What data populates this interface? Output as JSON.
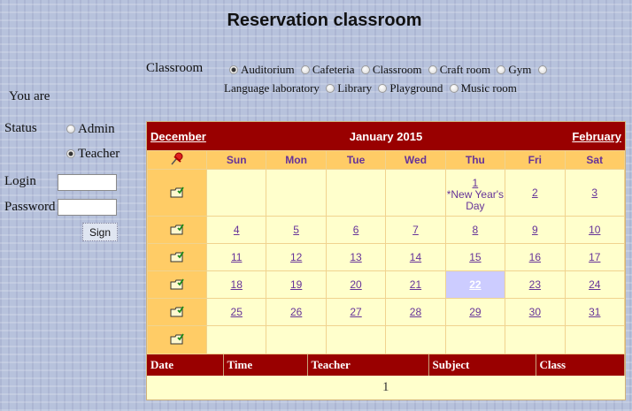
{
  "page": {
    "title": "Reservation classroom"
  },
  "classroom": {
    "label": "Classroom",
    "options": [
      {
        "label": "Auditorium",
        "checked": true
      },
      {
        "label": "Cafeteria",
        "checked": false
      },
      {
        "label": "Classroom",
        "checked": false
      },
      {
        "label": "Craft room",
        "checked": false
      },
      {
        "label": "Gym",
        "checked": false
      },
      {
        "label": "Language laboratory",
        "checked": false
      },
      {
        "label": "Library",
        "checked": false
      },
      {
        "label": "Playground",
        "checked": false
      },
      {
        "label": "Music room",
        "checked": false
      }
    ]
  },
  "login": {
    "you_are": "You are",
    "status_label": "Status",
    "status_options": [
      {
        "label": "Admin",
        "checked": false
      },
      {
        "label": "Teacher",
        "checked": true
      }
    ],
    "login_label": "Login",
    "password_label": "Password",
    "login_value": "",
    "password_value": "",
    "sign_label": "Sign"
  },
  "calendar": {
    "prev": "December",
    "month": "January 2015",
    "next": "February",
    "weekdays": [
      "Sun",
      "Mon",
      "Tue",
      "Wed",
      "Thu",
      "Fri",
      "Sat"
    ],
    "selector_icon": "pushpin-icon",
    "week_icon": "week-select-icon",
    "weeks": [
      [
        "",
        "",
        "",
        "",
        "1",
        "2",
        "3"
      ],
      [
        "4",
        "5",
        "6",
        "7",
        "8",
        "9",
        "10"
      ],
      [
        "11",
        "12",
        "13",
        "14",
        "15",
        "16",
        "17"
      ],
      [
        "18",
        "19",
        "20",
        "21",
        "22",
        "23",
        "24"
      ],
      [
        "25",
        "26",
        "27",
        "28",
        "29",
        "30",
        "31"
      ],
      [
        "",
        "",
        "",
        "",
        "",
        "",
        ""
      ]
    ],
    "holiday": {
      "day": "1",
      "text": "*New Year's Day"
    },
    "today": "22",
    "colors": {
      "title_bg": "#990000",
      "header_bg": "#ffcc66",
      "day_bg": "#ffffcc",
      "today_bg": "#ccccff",
      "text": "#663399"
    }
  },
  "reservations": {
    "columns": [
      "Date",
      "Time",
      "Teacher",
      "Subject",
      "Class"
    ],
    "pager": "1"
  }
}
